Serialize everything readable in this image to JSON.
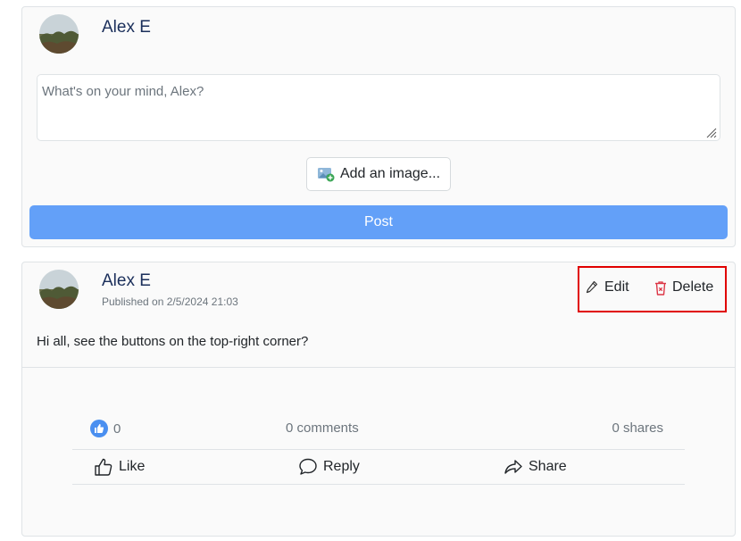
{
  "composer": {
    "author_name": "Alex E",
    "placeholder": "What's on your mind, Alex?",
    "add_image_label": "Add an image...",
    "post_label": "Post"
  },
  "post": {
    "author_name": "Alex E",
    "published": "Published on 2/5/2024 21:03",
    "text": "Hi all, see the buttons on the top-right corner?",
    "actions": {
      "edit_label": "Edit",
      "delete_label": "Delete"
    },
    "stats": {
      "likes": "0",
      "comments": "0 comments",
      "shares": "0 shares"
    },
    "bar": {
      "like_label": "Like",
      "reply_label": "Reply",
      "share_label": "Share"
    }
  },
  "colors": {
    "primary_button": "#63a0f8",
    "author_name": "#1b2f5b",
    "delete_icon": "#dc3545",
    "highlight_box": "#e00000",
    "like_badge": "#4a8ff0"
  },
  "icons": {
    "add_image": "image-plus-icon",
    "edit": "pencil-icon",
    "delete": "trash-icon",
    "like_badge": "thumbs-up-badge-icon",
    "like": "thumbs-up-icon",
    "reply": "speech-bubble-icon",
    "share": "share-arrow-icon"
  }
}
